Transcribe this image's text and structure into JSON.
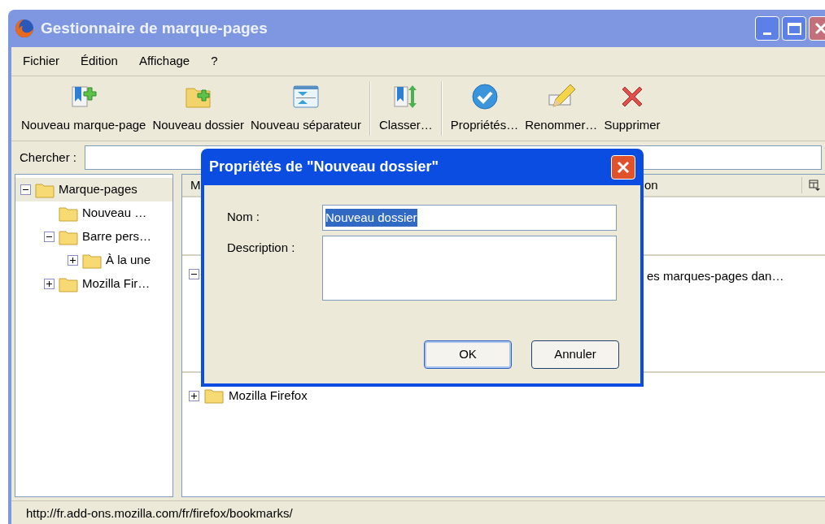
{
  "window": {
    "title": "Gestionnaire de marque-pages"
  },
  "menu": [
    {
      "label": "Fichier"
    },
    {
      "label": "Édition"
    },
    {
      "label": "Affichage"
    },
    {
      "label": "?"
    }
  ],
  "toolbar": [
    {
      "kind": "button",
      "label": "Nouveau marque-page"
    },
    {
      "kind": "button",
      "label": "Nouveau dossier"
    },
    {
      "kind": "button",
      "label": "Nouveau séparateur"
    },
    {
      "kind": "separator"
    },
    {
      "kind": "button",
      "label": "Classer…"
    },
    {
      "kind": "separator"
    },
    {
      "kind": "button",
      "label": "Propriétés…"
    },
    {
      "kind": "button",
      "label": "Renommer…"
    },
    {
      "kind": "button",
      "label": "Supprimer"
    }
  ],
  "search": {
    "label": "Chercher :"
  },
  "tree": [
    {
      "label": "Marque-pages",
      "expanded": true,
      "selected": true,
      "children": [
        {
          "label": "Nouveau …",
          "selected": false
        },
        {
          "label": "Barre pers…",
          "expanded": true,
          "selected": false,
          "children": [
            {
              "label": "À la une",
              "expanded": false,
              "selected": false
            }
          ]
        },
        {
          "label": "Mozilla Fir…",
          "expanded": false,
          "selected": false
        }
      ]
    }
  ],
  "list": {
    "columns": [
      "M",
      "on"
    ],
    "rows": [
      {
        "expanded": true,
        "description": "es marques-pages dan…"
      },
      {
        "expanded": false,
        "name": "Mozilla Firefox"
      }
    ]
  },
  "dialog": {
    "title": "Propriétés de \"Nouveau dossier\"",
    "fields": [
      {
        "kind": "input",
        "label": "Nom :",
        "value": "Nouveau dossier",
        "text_selected": true
      },
      {
        "kind": "textarea",
        "label": "Description :"
      }
    ],
    "buttons": [
      {
        "label": "OK",
        "default": true
      },
      {
        "label": "Annuler",
        "default": false
      }
    ]
  },
  "status_bar": "http://fr.add-ons.mozilla.com/fr/firefox/bookmarks/"
}
